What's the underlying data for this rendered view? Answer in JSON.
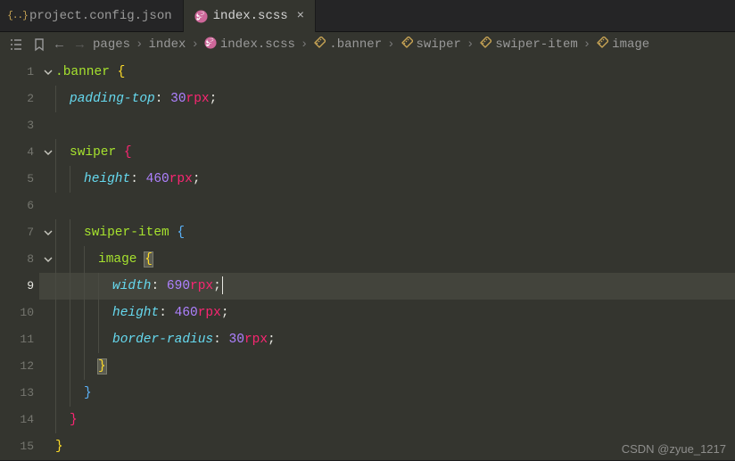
{
  "tabs": [
    {
      "label": "project.config.json",
      "icon": "json",
      "active": false
    },
    {
      "label": "index.scss",
      "icon": "scss",
      "active": true
    }
  ],
  "breadcrumb": {
    "items": [
      {
        "label": "pages",
        "icon": null
      },
      {
        "label": "index",
        "icon": null
      },
      {
        "label": "index.scss",
        "icon": "scss"
      },
      {
        "label": ".banner",
        "icon": "ruler"
      },
      {
        "label": "swiper",
        "icon": "ruler"
      },
      {
        "label": "swiper-item",
        "icon": "ruler"
      },
      {
        "label": "image",
        "icon": "ruler"
      }
    ]
  },
  "code": {
    "lines": [
      {
        "n": 1,
        "fold": true,
        "tokens": [
          {
            "t": ".banner ",
            "c": "sel"
          },
          {
            "t": "{",
            "c": "brace-yellow"
          }
        ],
        "indent": 0
      },
      {
        "n": 2,
        "tokens": [
          {
            "t": "padding-top",
            "c": "prop"
          },
          {
            "t": ": ",
            "c": "punc"
          },
          {
            "t": "30",
            "c": "num"
          },
          {
            "t": "rpx",
            "c": "unit"
          },
          {
            "t": ";",
            "c": "semi"
          }
        ],
        "indent": 1
      },
      {
        "n": 3,
        "tokens": [],
        "indent": 0
      },
      {
        "n": 4,
        "fold": true,
        "tokens": [
          {
            "t": "swiper ",
            "c": "sel"
          },
          {
            "t": "{",
            "c": "brace-pink"
          }
        ],
        "indent": 1
      },
      {
        "n": 5,
        "tokens": [
          {
            "t": "height",
            "c": "prop"
          },
          {
            "t": ": ",
            "c": "punc"
          },
          {
            "t": "460",
            "c": "num"
          },
          {
            "t": "rpx",
            "c": "unit"
          },
          {
            "t": ";",
            "c": "semi"
          }
        ],
        "indent": 2
      },
      {
        "n": 6,
        "tokens": [],
        "indent": 0
      },
      {
        "n": 7,
        "fold": true,
        "tokens": [
          {
            "t": "swiper-item ",
            "c": "sel"
          },
          {
            "t": "{",
            "c": "brace-blue"
          }
        ],
        "indent": 2
      },
      {
        "n": 8,
        "fold": true,
        "tokens": [
          {
            "t": "image ",
            "c": "sel"
          },
          {
            "t": "{",
            "c": "hl-brace"
          }
        ],
        "indent": 3
      },
      {
        "n": 9,
        "current": true,
        "tokens": [
          {
            "t": "width",
            "c": "prop"
          },
          {
            "t": ": ",
            "c": "punc"
          },
          {
            "t": "690",
            "c": "num"
          },
          {
            "t": "rpx",
            "c": "unit"
          },
          {
            "t": ";",
            "c": "semi"
          }
        ],
        "indent": 4,
        "cursor": true
      },
      {
        "n": 10,
        "tokens": [
          {
            "t": "height",
            "c": "prop"
          },
          {
            "t": ": ",
            "c": "punc"
          },
          {
            "t": "460",
            "c": "num"
          },
          {
            "t": "rpx",
            "c": "unit"
          },
          {
            "t": ";",
            "c": "semi"
          }
        ],
        "indent": 4
      },
      {
        "n": 11,
        "tokens": [
          {
            "t": "border-radius",
            "c": "prop"
          },
          {
            "t": ": ",
            "c": "punc"
          },
          {
            "t": "30",
            "c": "num"
          },
          {
            "t": "rpx",
            "c": "unit"
          },
          {
            "t": ";",
            "c": "semi"
          }
        ],
        "indent": 4
      },
      {
        "n": 12,
        "tokens": [
          {
            "t": "}",
            "c": "hl-brace"
          }
        ],
        "indent": 3
      },
      {
        "n": 13,
        "tokens": [
          {
            "t": "}",
            "c": "brace-blue"
          }
        ],
        "indent": 2
      },
      {
        "n": 14,
        "tokens": [
          {
            "t": "}",
            "c": "brace-pink"
          }
        ],
        "indent": 1
      },
      {
        "n": 15,
        "tokens": [
          {
            "t": "}",
            "c": "brace-yellow"
          }
        ],
        "indent": 0
      }
    ]
  },
  "watermark": "CSDN @zyue_1217"
}
